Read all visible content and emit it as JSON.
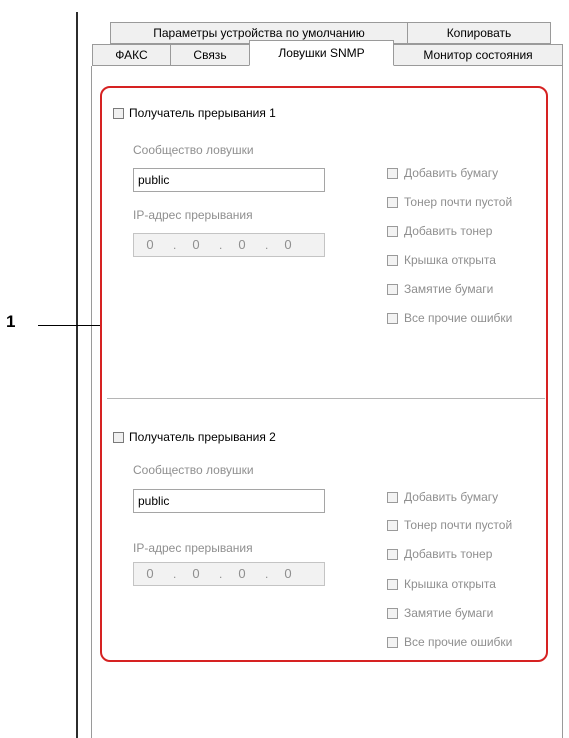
{
  "tabs": {
    "row_top": [
      "Параметры устройства по умолчанию",
      "Копировать"
    ],
    "row_bottom": [
      "ФАКС",
      "Связь",
      "Ловушки SNMP",
      "Монитор состояния"
    ]
  },
  "callout": {
    "number": "1"
  },
  "receivers": [
    {
      "title": "Получатель прерывания 1",
      "checked": false,
      "community_label": "Сообщество ловушки",
      "community_value": "public",
      "ip_label": "IP-адрес прерывания",
      "ip": [
        "0",
        "0",
        "0",
        "0"
      ],
      "events": [
        "Добавить бумагу",
        "Тонер почти пустой",
        "Добавить тонер",
        "Крышка открыта",
        "Замятие бумаги",
        "Все прочие ошибки"
      ]
    },
    {
      "title": "Получатель прерывания 2",
      "checked": false,
      "community_label": "Сообщество ловушки",
      "community_value": "public",
      "ip_label": "IP-адрес прерывания",
      "ip": [
        "0",
        "0",
        "0",
        "0"
      ],
      "events": [
        "Добавить бумагу",
        "Тонер почти пустой",
        "Добавить тонер",
        "Крышка открыта",
        "Замятие бумаги",
        "Все прочие ошибки"
      ]
    }
  ],
  "colors": {
    "callout_border": "#d62222",
    "disabled_text": "#8f8f8f"
  }
}
